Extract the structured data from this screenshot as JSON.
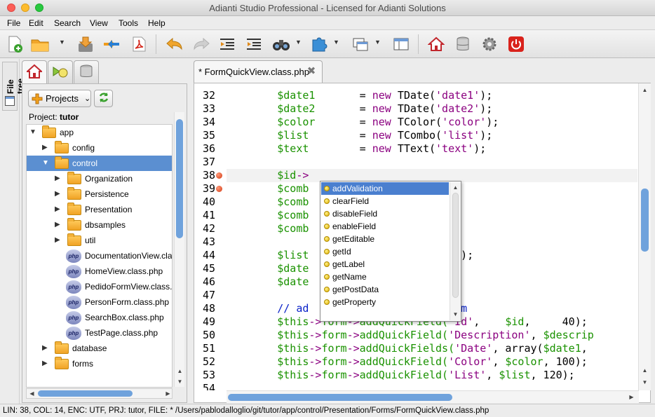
{
  "window": {
    "title": "Adianti Studio Professional - Licensed for Adianti Solutions"
  },
  "menu": [
    "File",
    "Edit",
    "Search",
    "View",
    "Tools",
    "Help"
  ],
  "toolbar": {
    "icons": [
      "new-file-icon",
      "open-folder-icon",
      "save-icon",
      "merge-arrows-icon",
      "pdf-icon",
      "undo-icon",
      "redo-icon",
      "unindent-icon",
      "indent-icon",
      "binoculars-icon",
      "puzzle-icon",
      "windows-icon",
      "layout-icon",
      "home-icon",
      "database-icon",
      "gear-icon",
      "power-icon"
    ]
  },
  "side_tab": {
    "label": "File tree"
  },
  "left_tabs": [
    "home-icon",
    "run-icon",
    "database-icon"
  ],
  "projects_button": {
    "label": "Projects"
  },
  "project": {
    "prefix": "Project: ",
    "name": "tutor"
  },
  "tree": [
    {
      "label": "app",
      "type": "folder",
      "indent": 0,
      "expanded": true
    },
    {
      "label": "config",
      "type": "folder",
      "indent": 1,
      "expanded": false
    },
    {
      "label": "control",
      "type": "folder",
      "indent": 1,
      "expanded": true,
      "selected": true
    },
    {
      "label": "Organization",
      "type": "folder",
      "indent": 2,
      "expanded": false
    },
    {
      "label": "Persistence",
      "type": "folder",
      "indent": 2,
      "expanded": false
    },
    {
      "label": "Presentation",
      "type": "folder",
      "indent": 2,
      "expanded": false
    },
    {
      "label": "dbsamples",
      "type": "folder",
      "indent": 2,
      "expanded": false
    },
    {
      "label": "util",
      "type": "folder",
      "indent": 2,
      "expanded": false
    },
    {
      "label": "DocumentationView.cla",
      "type": "php",
      "indent": 2
    },
    {
      "label": "HomeView.class.php",
      "type": "php",
      "indent": 2
    },
    {
      "label": "PedidoFormView.class.",
      "type": "php",
      "indent": 2
    },
    {
      "label": "PersonForm.class.php",
      "type": "php",
      "indent": 2
    },
    {
      "label": "SearchBox.class.php",
      "type": "php",
      "indent": 2
    },
    {
      "label": "TestPage.class.php",
      "type": "php",
      "indent": 2
    },
    {
      "label": "database",
      "type": "folder",
      "indent": 1,
      "expanded": false
    },
    {
      "label": "forms",
      "type": "folder",
      "indent": 1,
      "expanded": false
    }
  ],
  "editor": {
    "tab_label": "* FormQuickView.class.php",
    "current_line": 38,
    "breakpoints": [
      38,
      39
    ],
    "lines": [
      {
        "n": 32,
        "tokens": [
          [
            "        ",
            ""
          ],
          [
            "$date1",
            "v"
          ],
          [
            "       = ",
            ""
          ],
          [
            "new",
            "kw"
          ],
          [
            " TDate(",
            ""
          ],
          [
            "'date1'",
            "s"
          ],
          [
            ");",
            ""
          ]
        ]
      },
      {
        "n": 33,
        "tokens": [
          [
            "        ",
            ""
          ],
          [
            "$date2",
            "v"
          ],
          [
            "       = ",
            ""
          ],
          [
            "new",
            "kw"
          ],
          [
            " TDate(",
            ""
          ],
          [
            "'date2'",
            "s"
          ],
          [
            ");",
            ""
          ]
        ]
      },
      {
        "n": 34,
        "tokens": [
          [
            "        ",
            ""
          ],
          [
            "$color",
            "v"
          ],
          [
            "       = ",
            ""
          ],
          [
            "new",
            "kw"
          ],
          [
            " TColor(",
            ""
          ],
          [
            "'color'",
            "s"
          ],
          [
            ");",
            ""
          ]
        ]
      },
      {
        "n": 35,
        "tokens": [
          [
            "        ",
            ""
          ],
          [
            "$list",
            "v"
          ],
          [
            "        = ",
            ""
          ],
          [
            "new",
            "kw"
          ],
          [
            " TCombo(",
            ""
          ],
          [
            "'list'",
            "s"
          ],
          [
            ");",
            ""
          ]
        ]
      },
      {
        "n": 36,
        "tokens": [
          [
            "        ",
            ""
          ],
          [
            "$text",
            "v"
          ],
          [
            "        = ",
            ""
          ],
          [
            "new",
            "kw"
          ],
          [
            " TText(",
            ""
          ],
          [
            "'text'",
            "s"
          ],
          [
            ");",
            ""
          ]
        ]
      },
      {
        "n": 37,
        "tokens": []
      },
      {
        "n": 38,
        "tokens": [
          [
            "        ",
            ""
          ],
          [
            "$id",
            "v"
          ],
          [
            "->",
            "kw"
          ]
        ]
      },
      {
        "n": 39,
        "tokens": [
          [
            "        ",
            ""
          ],
          [
            "$comb",
            "v"
          ]
        ]
      },
      {
        "n": 40,
        "tokens": [
          [
            "        ",
            ""
          ],
          [
            "$comb",
            "v"
          ],
          [
            "                    ",
            ""
          ],
          [
            "a'",
            "s"
          ],
          [
            ";",
            ""
          ]
        ]
      },
      {
        "n": 41,
        "tokens": [
          [
            "        ",
            ""
          ],
          [
            "$comb",
            "v"
          ],
          [
            "                    ",
            ""
          ],
          [
            "b'",
            "s"
          ],
          [
            ";",
            ""
          ]
        ]
      },
      {
        "n": 42,
        "tokens": [
          [
            "        ",
            ""
          ],
          [
            "$comb",
            "v"
          ],
          [
            "                    ",
            ""
          ],
          [
            "c'",
            "s"
          ],
          [
            ";",
            ""
          ]
        ]
      },
      {
        "n": 43,
        "tokens": []
      },
      {
        "n": 44,
        "tokens": [
          [
            "        ",
            ""
          ],
          [
            "$list",
            "v"
          ],
          [
            "                    ",
            ""
          ],
          [
            "tems",
            "v"
          ],
          [
            ");",
            ""
          ]
        ]
      },
      {
        "n": 45,
        "tokens": [
          [
            "        ",
            ""
          ],
          [
            "$date",
            "v"
          ]
        ]
      },
      {
        "n": 46,
        "tokens": [
          [
            "        ",
            ""
          ],
          [
            "$date",
            "v"
          ]
        ]
      },
      {
        "n": 47,
        "tokens": []
      },
      {
        "n": 48,
        "tokens": [
          [
            "        ",
            ""
          ],
          [
            "// ad",
            "cm"
          ],
          [
            "                 ",
            ""
          ],
          [
            "the form",
            "cm"
          ]
        ]
      },
      {
        "n": 49,
        "tokens": [
          [
            "        ",
            ""
          ],
          [
            "$this",
            "v"
          ],
          [
            "->",
            "kw"
          ],
          [
            "form",
            "v"
          ],
          [
            "->",
            "kw"
          ],
          [
            "addQuickField(",
            "v"
          ],
          [
            "'Id'",
            "s"
          ],
          [
            ",    ",
            ""
          ],
          [
            "$id",
            "v"
          ],
          [
            ",     40);",
            ""
          ]
        ]
      },
      {
        "n": 50,
        "tokens": [
          [
            "        ",
            ""
          ],
          [
            "$this",
            "v"
          ],
          [
            "->",
            "kw"
          ],
          [
            "form",
            "v"
          ],
          [
            "->",
            "kw"
          ],
          [
            "addQuickField(",
            "v"
          ],
          [
            "'Description'",
            "s"
          ],
          [
            ", ",
            ""
          ],
          [
            "$descrip",
            "v"
          ]
        ]
      },
      {
        "n": 51,
        "tokens": [
          [
            "        ",
            ""
          ],
          [
            "$this",
            "v"
          ],
          [
            "->",
            "kw"
          ],
          [
            "form",
            "v"
          ],
          [
            "->",
            "kw"
          ],
          [
            "addQuickFields(",
            "v"
          ],
          [
            "'Date'",
            "s"
          ],
          [
            ", array(",
            ""
          ],
          [
            "$date1",
            "v"
          ],
          [
            ",",
            ""
          ]
        ]
      },
      {
        "n": 52,
        "tokens": [
          [
            "        ",
            ""
          ],
          [
            "$this",
            "v"
          ],
          [
            "->",
            "kw"
          ],
          [
            "form",
            "v"
          ],
          [
            "->",
            "kw"
          ],
          [
            "addQuickField(",
            "v"
          ],
          [
            "'Color'",
            "s"
          ],
          [
            ", ",
            ""
          ],
          [
            "$color",
            "v"
          ],
          [
            ", 100);",
            ""
          ]
        ]
      },
      {
        "n": 53,
        "tokens": [
          [
            "        ",
            ""
          ],
          [
            "$this",
            "v"
          ],
          [
            "->",
            "kw"
          ],
          [
            "form",
            "v"
          ],
          [
            "->",
            "kw"
          ],
          [
            "addQuickField(",
            "v"
          ],
          [
            "'List'",
            "s"
          ],
          [
            ", ",
            ""
          ],
          [
            "$list",
            "v"
          ],
          [
            ", 120);",
            ""
          ]
        ]
      },
      {
        "n": 54,
        "tokens": []
      }
    ]
  },
  "autocomplete": {
    "selected": 0,
    "items": [
      "addValidation",
      "clearField",
      "disableField",
      "enableField",
      "getEditable",
      "getId",
      "getLabel",
      "getName",
      "getPostData",
      "getProperty"
    ]
  },
  "status": "LIN: 38, COL: 14, ENC: UTF, PRJ: tutor, FILE: * /Users/pablodalloglio/git/tutor/app/control/Presentation/Forms/FormQuickView.class.php",
  "colors": {
    "selection": "#5b8fd1",
    "variable": "#1a9200",
    "keyword": "#8b0080",
    "comment": "#0a22c8"
  }
}
